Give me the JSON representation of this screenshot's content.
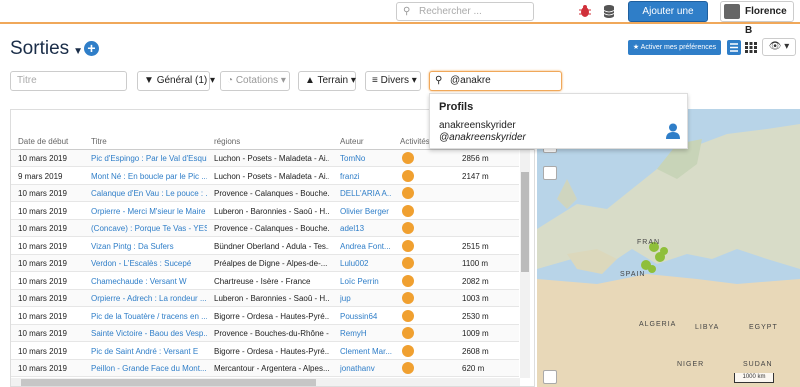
{
  "topbar": {
    "search_placeholder": "Rechercher ...",
    "add_button": "Ajouter une sortie",
    "user_name": "Florence B"
  },
  "header": {
    "title": "Sorties",
    "prefs_button": "Activer mes préférences"
  },
  "filters": {
    "titre_placeholder": "Titre",
    "general": "Général (1)",
    "cotations": "Cotations",
    "terrain": "Terrain",
    "divers": "Divers",
    "search_value": "@anakre"
  },
  "dropdown": {
    "heading": "Profils",
    "name": "anakreenskyrider",
    "handle": "@anakreenskyrider"
  },
  "table": {
    "columns": [
      "Date de début",
      "Titre",
      "régions",
      "Auteur",
      "Activités"
    ],
    "rows": [
      {
        "date": "10 mars 2019",
        "title": "Pic d'Espingo : Par le Val d'Esqui...",
        "region": "Luchon - Posets - Maladeta - Ai...",
        "author": "TomNo",
        "alt": "2856 m"
      },
      {
        "date": "9 mars 2019",
        "title": "Mont Né : En boucle par le Pic ...",
        "region": "Luchon - Posets - Maladeta - Ai...",
        "author": "franzi",
        "alt": "2147 m"
      },
      {
        "date": "10 mars 2019",
        "title": "Calanque d'En Vau : Le pouce : ...",
        "region": "Provence - Calanques - Bouche...",
        "author": "DELL'ARIA A...",
        "alt": ""
      },
      {
        "date": "10 mars 2019",
        "title": "Orpierre - Merci M'sieur le Maire",
        "region": "Luberon - Baronnies - Saoû - H...",
        "author": "Olivier Berger",
        "alt": ""
      },
      {
        "date": "10 mars 2019",
        "title": "(Concave) : Porque Te Vas - YES...",
        "region": "Provence - Calanques - Bouche...",
        "author": "adel13",
        "alt": ""
      },
      {
        "date": "10 mars 2019",
        "title": "Vizan Pintg : Da Sufers",
        "region": "Bündner Oberland - Adula - Tes...",
        "author": "Andrea Font...",
        "alt": "2515 m"
      },
      {
        "date": "10 mars 2019",
        "title": "Verdon - L'Escalès : Sucepé",
        "region": "Préalpes de Digne - Alpes-de-...",
        "author": "Lulu002",
        "alt": "1100 m"
      },
      {
        "date": "10 mars 2019",
        "title": "Chamechaude : Versant W",
        "region": "Chartreuse - Isère - France",
        "author": "Loïc Perrin",
        "alt": "2082 m"
      },
      {
        "date": "10 mars 2019",
        "title": "Orpierre - Adrech : La rondeur ...",
        "region": "Luberon - Baronnies - Saoû - H...",
        "author": "jup",
        "alt": "1003 m"
      },
      {
        "date": "10 mars 2019",
        "title": "Pic de la Touatère / tracens en ...",
        "region": "Bigorre - Ordesa - Hautes-Pyré...",
        "author": "Poussin64",
        "alt": "2530 m"
      },
      {
        "date": "10 mars 2019",
        "title": "Sainte Victoire - Baou des Vesp...",
        "region": "Provence - Bouches-du-Rhône -...",
        "author": "RemyH",
        "alt": "1009 m"
      },
      {
        "date": "10 mars 2019",
        "title": "Pic de Saint André : Versant E",
        "region": "Bigorre - Ordesa - Hautes-Pyré...",
        "author": "Clement Mar...",
        "alt": "2608 m"
      },
      {
        "date": "10 mars 2019",
        "title": "Peillon - Grande Face du Mont...",
        "region": "Mercantour - Argentera - Alpes...",
        "author": "jonathanv",
        "alt": "620 m"
      }
    ]
  },
  "map": {
    "labels": [
      "FRAN",
      "SPAIN",
      "ALGERIA",
      "LIBYA",
      "EGYPT",
      "NIGER",
      "SUDAN"
    ],
    "scale": "1000 km"
  },
  "colors": {
    "accent": "#2f7ec8",
    "topbar_border": "#f0a85a",
    "activity": "#f0a030"
  }
}
